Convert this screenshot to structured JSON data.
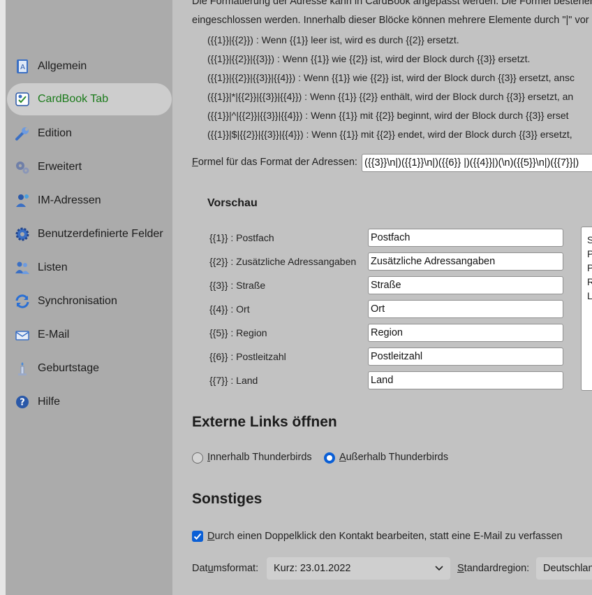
{
  "sidebar": {
    "items": [
      {
        "label": "Allgemein",
        "icon": "general-book-icon"
      },
      {
        "label": "CardBook Tab",
        "icon": "cardbook-tab-icon"
      },
      {
        "label": "Edition",
        "icon": "wrench-icon"
      },
      {
        "label": "Erweitert",
        "icon": "gears-icon"
      },
      {
        "label": "IM-Adressen",
        "icon": "im-person-icon"
      },
      {
        "label": "Benutzerdefinierte Felder",
        "icon": "custom-fields-gear-icon"
      },
      {
        "label": "Listen",
        "icon": "people-list-icon"
      },
      {
        "label": "Synchronisation",
        "icon": "sync-arrows-icon"
      },
      {
        "label": "E-Mail",
        "icon": "mail-envelope-icon"
      },
      {
        "label": "Geburtstage",
        "icon": "birthday-candle-icon"
      },
      {
        "label": "Hilfe",
        "icon": "help-question-icon"
      }
    ],
    "active_index": 1,
    "active_color": "#1a7a1a"
  },
  "format": {
    "intro_line1": "Die Formatierung der Adresse kann in CardBook angepasst werden. Die Formel bestehend",
    "intro_line2": "eingeschlossen werden. Innerhalb dieser Blöcke können mehrere Elemente durch \"|\" vor",
    "rules": [
      "({{1}}|{{2}}) : Wenn {{1}} leer ist, wird es durch {{2}} ersetzt.",
      "({{1}}|{{2}}|{{3}}) : Wenn {{1}} wie {{2}} ist, wird der Block durch {{3}} ersetzt.",
      "({{1}}|{{2}}|{{3}}|{{4}}) : Wenn {{1}} wie {{2}} ist, wird der Block durch {{3}} ersetzt, ansc",
      "({{1}}|*|{{2}}|{{3}}|{{4}}) : Wenn {{1}} {{2}} enthält, wird der Block durch {{3}} ersetzt, an",
      "({{1}}|^|{{2}}|{{3}}|{{4}}) : Wenn {{1}} mit {{2}} beginnt, wird der Block durch {{3}} erset",
      "({{1}}|$|{{2}}|{{3}}|{{4}}) : Wenn {{1}} mit {{2}} endet, wird der Block durch {{3}} ersetzt,"
    ],
    "formula_label_first": "F",
    "formula_label_rest": "ormel für das Format der Adressen:",
    "formula_value": "({{3}}\\n|)({{1}}\\n|)({{6}} |)({{4}}|)(\\n)({{5}}\\n|)({{7}}|)"
  },
  "preview": {
    "title": "Vorschau",
    "fields": [
      {
        "label": "{{1}} : Postfach",
        "value": "Postfach"
      },
      {
        "label": "{{2}} : Zusätzliche Adressangaben",
        "value": "Zusätzliche Adressangaben"
      },
      {
        "label": "{{3}} : Straße",
        "value": "Straße"
      },
      {
        "label": "{{4}} : Ort",
        "value": "Ort"
      },
      {
        "label": "{{5}} : Region",
        "value": "Region"
      },
      {
        "label": "{{6}} : Postleitzahl",
        "value": "Postleitzahl"
      },
      {
        "label": "{{7}} : Land",
        "value": "Land"
      }
    ],
    "result_lines": [
      "S",
      "P",
      "P",
      "R",
      "L"
    ]
  },
  "links": {
    "title": "Externe Links öffnen",
    "option_inside_first": "I",
    "option_inside_rest": "nnerhalb Thunderbirds",
    "option_outside_first": "A",
    "option_outside_rest": "ußerhalb Thunderbirds",
    "selected": "outside",
    "accent": "#0a5fd6"
  },
  "misc": {
    "title": "Sonstiges",
    "doubleclick_first": "D",
    "doubleclick_rest": "urch einen Doppelklick den Kontakt bearbeiten, statt eine E-Mail zu verfassen",
    "doubleclick_checked": true,
    "date_label_pre": "Dat",
    "date_label_u": "u",
    "date_label_post": "msformat:",
    "date_value": "Kurz: 23.01.2022",
    "region_label_first": "S",
    "region_label_rest": "tandardregion:",
    "region_value": "Deutschlan"
  }
}
